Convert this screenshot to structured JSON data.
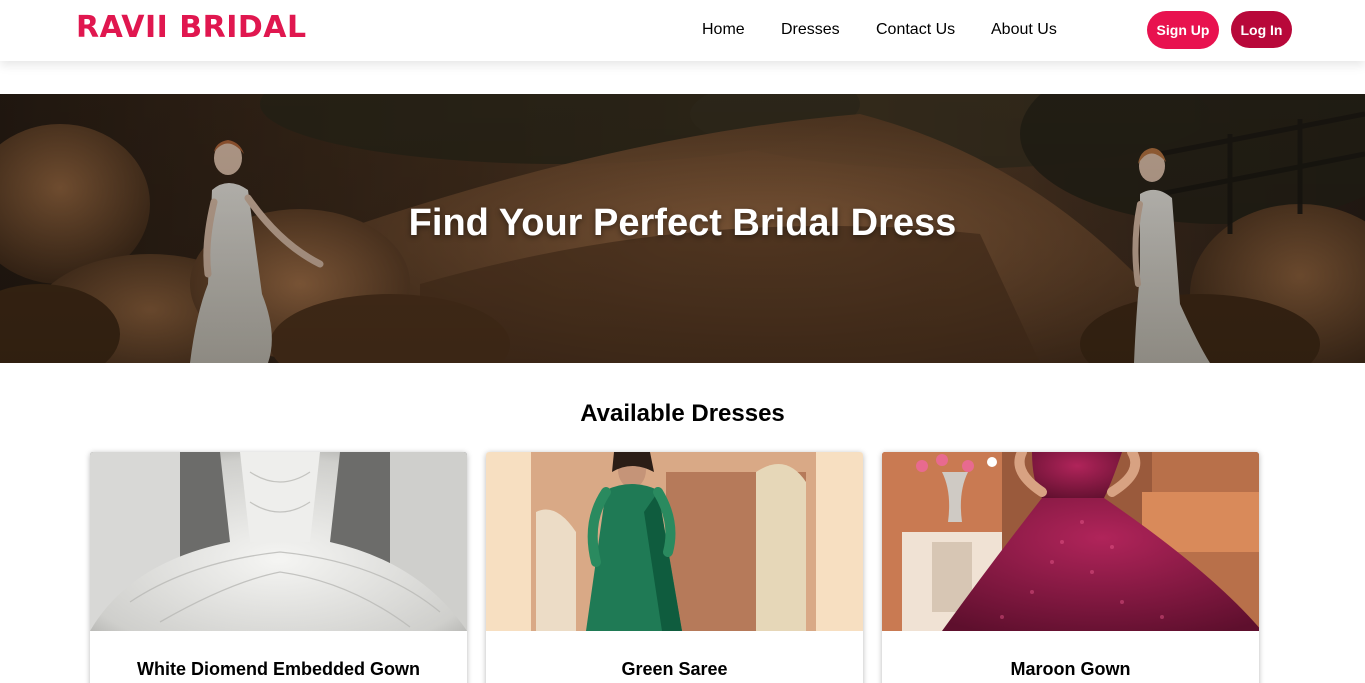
{
  "brand": {
    "name": "RAVII BRIDAL",
    "color": "#e0174f"
  },
  "nav": {
    "links": [
      {
        "label": "Home"
      },
      {
        "label": "Dresses"
      },
      {
        "label": "Contact Us"
      },
      {
        "label": "About Us"
      }
    ],
    "signup_label": "Sign Up",
    "login_label": "Log In",
    "signup_color": "#e8124f",
    "login_color": "#b8083a"
  },
  "hero": {
    "title": "Find Your Perfect Bridal Dress",
    "image": "hero-brides-rocks-image"
  },
  "section": {
    "title": "Available Dresses"
  },
  "dresses": [
    {
      "name": "White Diomend Embedded Gown",
      "image": "white-gown-image"
    },
    {
      "name": "Green Saree",
      "image": "green-saree-image"
    },
    {
      "name": "Maroon Gown",
      "image": "maroon-gown-image"
    }
  ]
}
